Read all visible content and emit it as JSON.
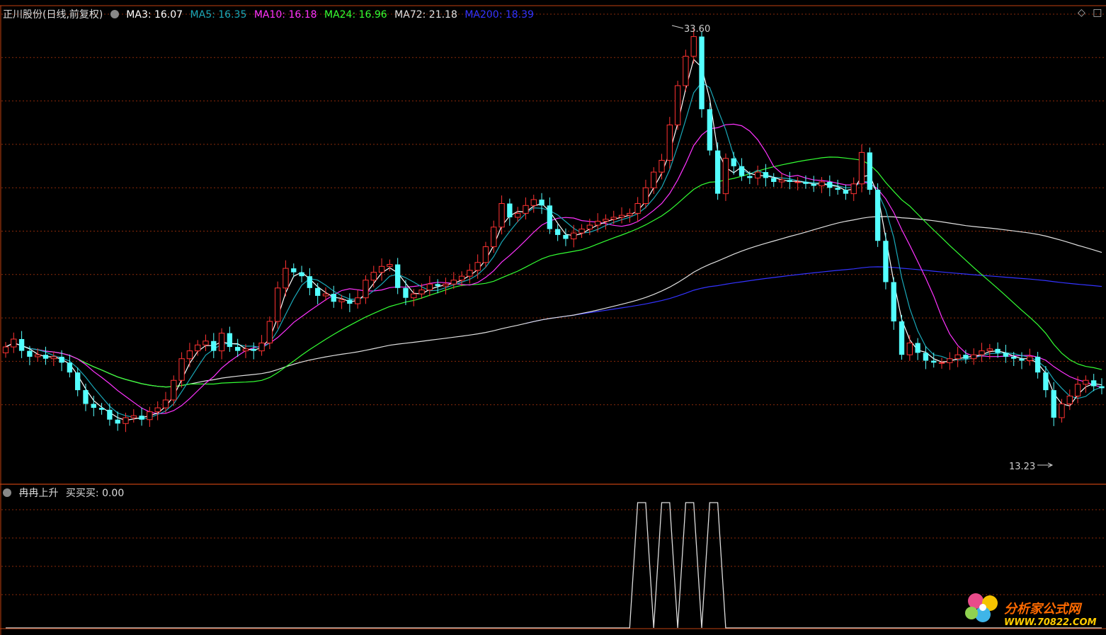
{
  "header": {
    "stock_title": "正川股份(日线,前复权)",
    "ma_items": [
      {
        "label": "MA3: 16.07",
        "color": "#ffffff"
      },
      {
        "label": "MA5: 16.35",
        "color": "#1aa8b8"
      },
      {
        "label": "MA10: 16.18",
        "color": "#ff33ff"
      },
      {
        "label": "MA24: 16.96",
        "color": "#33ff33"
      },
      {
        "label": "MA72: 21.18",
        "color": "#e0e0e0"
      },
      {
        "label": "MA200: 18.39",
        "color": "#3333ff"
      }
    ]
  },
  "indicator_header": {
    "title": "冉冉上升",
    "value_label": "买买买: 0.00"
  },
  "annotations": {
    "high_label": "33.60",
    "low_label": "13.23"
  },
  "watermark": {
    "name": "分析家公式网",
    "url": "WWW.70822.COM"
  },
  "colors": {
    "up": "#ff3232",
    "down": "#54ffff",
    "grid": "#8a2a0a",
    "divider": "#c04010"
  },
  "chart_data": [
    {
      "type": "candlestick",
      "title": "正川股份(日线,前复权)",
      "ylim": [
        11.5,
        35.5
      ],
      "grid": true,
      "annotations": [
        {
          "label": "33.60",
          "value": 33.6
        },
        {
          "label": "13.23",
          "value": 13.23
        }
      ],
      "close": [
        18.2,
        18.6,
        18.0,
        17.7,
        17.8,
        17.6,
        17.7,
        17.4,
        16.9,
        16.0,
        15.3,
        15.1,
        15.0,
        14.5,
        14.3,
        14.6,
        14.7,
        14.5,
        14.9,
        15.1,
        15.5,
        16.5,
        17.6,
        18.0,
        18.3,
        18.5,
        18.0,
        18.9,
        18.2,
        18.0,
        18.1,
        18.0,
        18.4,
        19.5,
        21.2,
        22.2,
        22.0,
        21.8,
        21.2,
        20.8,
        20.9,
        20.5,
        20.6,
        20.4,
        20.7,
        21.6,
        22.0,
        22.3,
        22.4,
        21.2,
        20.7,
        20.9,
        21.1,
        21.4,
        21.3,
        21.4,
        21.6,
        21.8,
        22.1,
        22.5,
        23.3,
        24.3,
        25.5,
        24.8,
        25.0,
        25.4,
        25.7,
        25.4,
        24.2,
        23.9,
        23.7,
        24.0,
        24.2,
        24.4,
        24.6,
        24.7,
        24.8,
        24.9,
        25.0,
        25.5,
        26.3,
        27.1,
        27.7,
        29.5,
        31.5,
        33.0,
        34.0,
        30.3,
        28.2,
        26.0,
        27.8,
        27.4,
        26.9,
        26.8,
        27.1,
        26.8,
        26.6,
        26.7,
        26.6,
        26.6,
        26.5,
        26.4,
        26.6,
        26.3,
        26.2,
        26.0,
        26.5,
        28.1,
        26.2,
        23.6,
        21.5,
        19.5,
        17.8,
        18.4,
        17.9,
        17.5,
        17.4,
        17.4,
        17.6,
        17.8,
        17.6,
        17.8,
        18.0,
        18.1,
        17.9,
        17.7,
        17.6,
        17.5,
        17.7,
        16.9,
        16.0,
        14.6,
        15.3,
        15.7,
        16.3,
        16.5,
        16.2,
        16.1
      ]
    },
    {
      "type": "line",
      "title": "冉冉上升",
      "series": [
        {
          "name": "买买买",
          "values": [
            0,
            0,
            0,
            0,
            0,
            0,
            0,
            0,
            0,
            0,
            0,
            0,
            0,
            0,
            0,
            0,
            0,
            0,
            0,
            0,
            0,
            0,
            0,
            0,
            0,
            0,
            0,
            0,
            0,
            0,
            0,
            0,
            0,
            0,
            0,
            0,
            0,
            0,
            0,
            0,
            0,
            0,
            0,
            0,
            0,
            0,
            0,
            0,
            0,
            0,
            0,
            0,
            0,
            0,
            0,
            0,
            0,
            0,
            0,
            0,
            0,
            0,
            0,
            0,
            0,
            0,
            0,
            0,
            0,
            0,
            0,
            0,
            0,
            0,
            0,
            0,
            0,
            0,
            0,
            1,
            1,
            0,
            1,
            1,
            0,
            1,
            1,
            0,
            1,
            1,
            0,
            0,
            0,
            0,
            0,
            0,
            0,
            0,
            0,
            0,
            0,
            0,
            0,
            0,
            0,
            0,
            0,
            0,
            0,
            0,
            0,
            0,
            0,
            0,
            0,
            0,
            0,
            0,
            0,
            0,
            0,
            0,
            0,
            0,
            0,
            0,
            0,
            0,
            0,
            0,
            0,
            0,
            0,
            0,
            0,
            0,
            0,
            0,
            0,
            0
          ]
        }
      ],
      "ylim": [
        0,
        1
      ]
    }
  ]
}
